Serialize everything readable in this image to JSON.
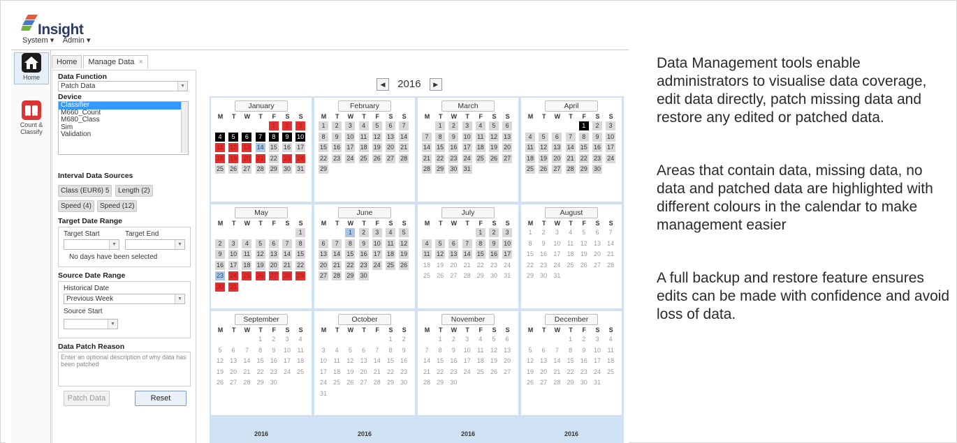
{
  "app": {
    "logo_text": "Insight",
    "menu": [
      "System ▾",
      "Admin ▾"
    ]
  },
  "nav": [
    {
      "label": "Home",
      "icon": "home-icon"
    },
    {
      "label": "Count & Classify",
      "icon": "vehicle-icon"
    }
  ],
  "tabs": [
    {
      "label": "Home"
    },
    {
      "label": "Manage Data",
      "close": "×"
    }
  ],
  "form": {
    "data_function_label": "Data Function",
    "data_function_value": "Patch Data",
    "device_label": "Device",
    "devices": [
      "Classifier",
      "M660_Count",
      "M680_Class",
      "Sim",
      "Validation"
    ],
    "device_selected": "Classifier",
    "interval_label": "Interval Data Sources",
    "chips": [
      "Class (EUR6) 5",
      "Length (2)",
      "Speed (4)",
      "Speed (12)"
    ],
    "target_range_label": "Target Date Range",
    "target_start": "Target Start",
    "target_end": "Target End",
    "no_days": "No days have been selected",
    "source_range_label": "Source Date Range",
    "historical_date": "Historical Date",
    "historical_value": "Previous Week",
    "source_start": "Source Start",
    "reason_label": "Data Patch Reason",
    "reason_placeholder": "Enter an optional description of why data has been patched",
    "patch_button": "Patch Data",
    "reset_button": "Reset"
  },
  "calendar": {
    "year": "2016",
    "prev": "◀",
    "next": "▶",
    "dow": [
      "M",
      "T",
      "W",
      "T",
      "F",
      "S",
      "S"
    ],
    "legend_colors": {
      "data": "#d8d8d8",
      "missing": "#e03030",
      "no_data": "#000000",
      "patched": "#a9c6e4"
    },
    "months": [
      {
        "name": "January",
        "start": 4,
        "days": 31,
        "miss": [
          1,
          2,
          3,
          11,
          12,
          13,
          18,
          19,
          20,
          21,
          23,
          24
        ],
        "none": [
          4,
          5,
          6,
          7,
          8,
          9,
          10
        ],
        "patch": [
          14
        ],
        "data_upto": 31
      },
      {
        "name": "February",
        "start": 0,
        "days": 29,
        "miss": [],
        "none": [],
        "patch": [],
        "data_upto": 29
      },
      {
        "name": "March",
        "start": 1,
        "days": 31,
        "miss": [],
        "none": [],
        "patch": [],
        "data_upto": 31
      },
      {
        "name": "April",
        "start": 4,
        "days": 30,
        "miss": [],
        "none": [
          1
        ],
        "patch": [],
        "data_upto": 30
      },
      {
        "name": "May",
        "start": 6,
        "days": 31,
        "miss": [
          24,
          25,
          26,
          27,
          28,
          29,
          30,
          31
        ],
        "none": [],
        "patch": [
          23
        ],
        "data_upto": 31
      },
      {
        "name": "June",
        "start": 2,
        "days": 30,
        "miss": [],
        "none": [],
        "patch": [
          1
        ],
        "data_upto": 30
      },
      {
        "name": "July",
        "start": 4,
        "days": 31,
        "miss": [],
        "none": [],
        "patch": [],
        "data_upto": 17
      },
      {
        "name": "August",
        "start": 0,
        "days": 31,
        "miss": [],
        "none": [],
        "patch": [],
        "data_upto": 0
      },
      {
        "name": "September",
        "start": 3,
        "days": 30,
        "miss": [],
        "none": [],
        "patch": [],
        "data_upto": 0
      },
      {
        "name": "October",
        "start": 5,
        "days": 31,
        "miss": [],
        "none": [],
        "patch": [],
        "data_upto": 0
      },
      {
        "name": "November",
        "start": 1,
        "days": 30,
        "miss": [],
        "none": [],
        "patch": [],
        "data_upto": 0
      },
      {
        "name": "December",
        "start": 3,
        "days": 31,
        "miss": [],
        "none": [],
        "patch": [],
        "data_upto": 0
      }
    ]
  },
  "description": {
    "p1": "Data Management tools enable administrators to visualise data coverage, edit data directly, patch missing data and restore any edited or patched data.",
    "p2": "Areas that contain data, missing data, no data and patched data are highlighted with different colours in the calendar to make management easier",
    "p3": "A full backup and restore feature ensures edits can be made with confidence and avoid loss of data."
  }
}
